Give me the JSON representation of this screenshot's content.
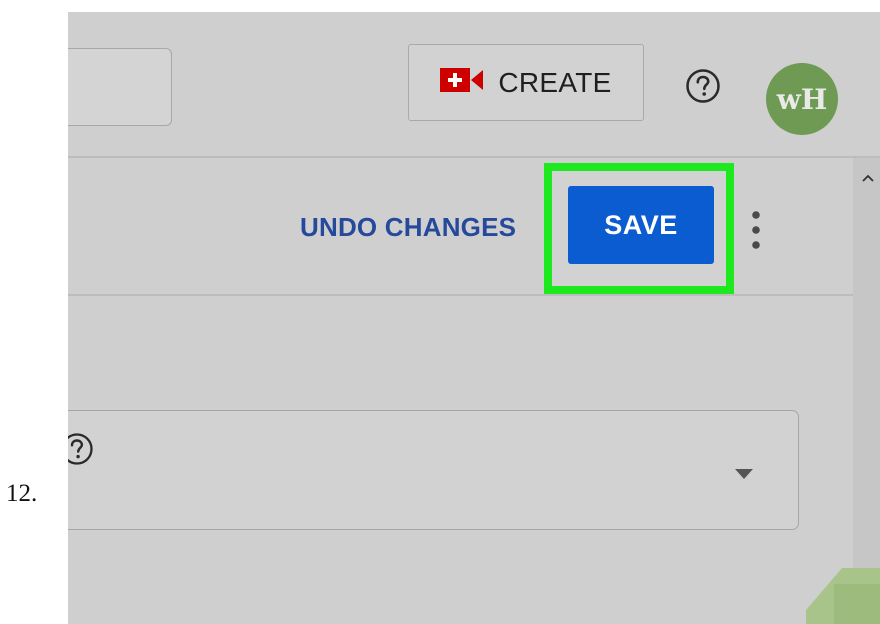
{
  "step_number": "12.",
  "header": {
    "create_label": "CREATE",
    "avatar_text": "wH",
    "icons": [
      "video-add-icon",
      "help-icon"
    ]
  },
  "action_bar": {
    "undo_label": "UNDO CHANGES",
    "save_label": "SAVE",
    "more_icon": "more-vertical-icon"
  },
  "field": {
    "help_icon": "help-icon",
    "dropdown_icon": "caret-down-icon"
  },
  "colors": {
    "save_button": "#0b5bd1",
    "highlight_frame": "#1ee81e",
    "undo_text": "#26499c",
    "create_icon": "#cc0000",
    "avatar_bg": "#6f9a53",
    "screen_bg": "#cfcfcf"
  }
}
